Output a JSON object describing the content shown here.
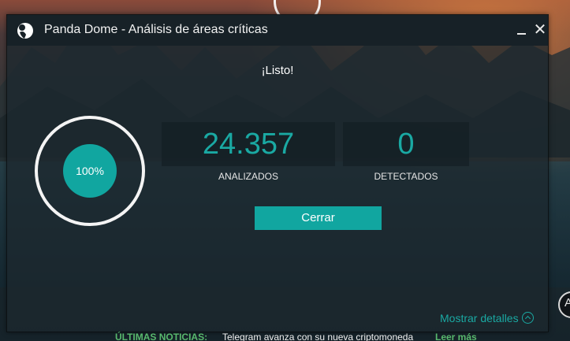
{
  "window": {
    "title": "Panda Dome - Análisis de áreas críticas",
    "status": "¡Listo!",
    "progress": {
      "value": 100,
      "label": "100%"
    },
    "stats": [
      {
        "value": "24.357",
        "label": "ANALIZADOS"
      },
      {
        "value": "0",
        "label": "DETECTADOS"
      }
    ],
    "close_button": "Cerrar",
    "details_link": "Mostrar detalles"
  },
  "news": {
    "label": "ÚLTIMAS NOTICIAS:",
    "headline": "Telegram avanza con su nueva criptomoneda",
    "link": "Leer más"
  },
  "background_badge": "A",
  "colors": {
    "accent": "#11a6a0",
    "news_green": "#58b86d",
    "titlebar": "#172127"
  },
  "icons": [
    "panda-logo-icon",
    "minimize-icon",
    "close-icon",
    "chevron-up-circle-icon"
  ]
}
